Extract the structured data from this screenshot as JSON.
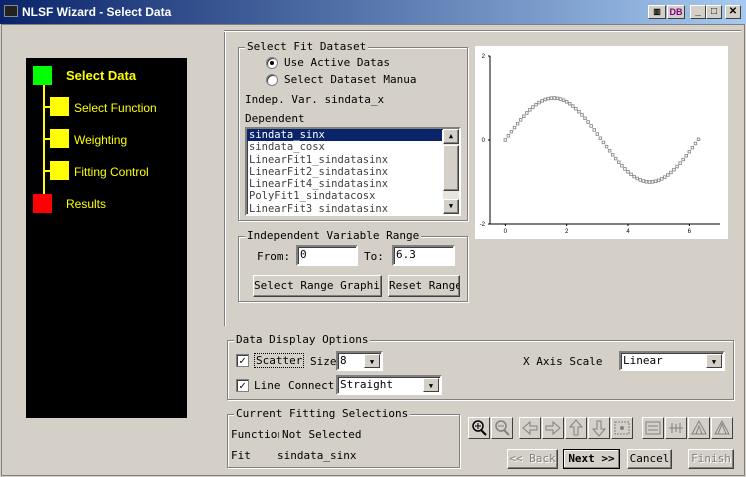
{
  "window": {
    "title": "NLSF Wizard - Select Data"
  },
  "nav": {
    "items": [
      {
        "label": "Select Data",
        "color": "#00ff00"
      },
      {
        "label": "Select Function",
        "color": "#ffff00"
      },
      {
        "label": "Weighting",
        "color": "#ffff00"
      },
      {
        "label": "Fitting Control",
        "color": "#ffff00"
      },
      {
        "label": "Results",
        "color": "#ff0000"
      }
    ]
  },
  "select_fit_dataset": {
    "title": "Select Fit Dataset",
    "use_active": "Use Active Datas",
    "select_manual": "Select Dataset Manua",
    "indep_var": "Indep. Var. sindata_x",
    "dependent_label": "Dependent",
    "datasets": [
      "sindata_sinx",
      "sindata_cosx",
      "LinearFit1_sindatasinx",
      "LinearFit2_sindatasinx",
      "LinearFit4_sindatasinx",
      "PolyFit1_sindatacosx",
      "LinearFit3_sindatasinx"
    ]
  },
  "indep_range": {
    "title": "Independent Variable Range",
    "from_label": "From:",
    "from_value": "0",
    "to_label": "To:",
    "to_value": "6.3",
    "select_graphically": "Select Range Graphically",
    "reset_range": "Reset Range"
  },
  "chart_data": {
    "type": "scatter",
    "x_ticks": [
      "0",
      "2",
      "4",
      "6"
    ],
    "y_ticks": [
      "2",
      "0",
      "-2"
    ],
    "xlim": [
      -0.5,
      7
    ],
    "ylim": [
      -2,
      2
    ],
    "function": "sin(x)",
    "x_range": [
      0,
      6.3
    ],
    "point_count": 64
  },
  "display_options": {
    "title": "Data Display Options",
    "scatter_label": "Scatter",
    "scatter_checked": true,
    "size_label": "Size",
    "size_value": "8",
    "line_label": "Line",
    "line_checked": true,
    "connect_label": "Connect",
    "connect_value": "Straight",
    "x_axis_label": "X Axis Scale",
    "x_axis_value": "Linear"
  },
  "current": {
    "title": "Current Fitting Selections",
    "function_label": "Function",
    "function_value": "Not Selected",
    "fit_label": "Fit",
    "fit_value": "sindata_sinx"
  },
  "buttons": {
    "back": "<< Back",
    "next": "Next >>",
    "cancel": "Cancel",
    "finish": "Finish"
  }
}
